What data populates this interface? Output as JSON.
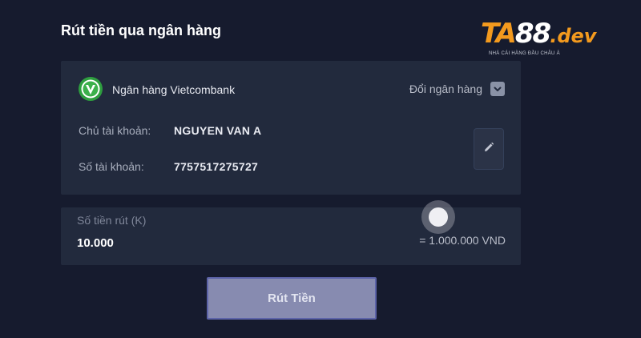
{
  "page": {
    "title": "Rút tiền qua ngân hàng"
  },
  "logo": {
    "brand_main": "TA",
    "brand_num": "88",
    "brand_suffix": ".dev",
    "tagline": "NHÀ CÁI HÀNG ĐẦU CHÂU Á"
  },
  "bank": {
    "icon": "vietcombank-logo-icon",
    "name": "Ngân hàng Vietcombank",
    "change_label": "Đổi ngân hàng",
    "holder_label": "Chủ tài khoản:",
    "holder_value": "NGUYEN VAN A",
    "account_label": "Số tài khoản:",
    "account_value": "7757517275727",
    "edit_icon": "pencil-icon"
  },
  "amount": {
    "placeholder": "Số tiền rút (K)",
    "value": "10.000",
    "converted": "= 1.000.000 VND"
  },
  "submit": {
    "label": "Rút Tiền"
  },
  "colors": {
    "background": "#161b2e",
    "card": "#222a3d",
    "accent_orange": "#f39a1e",
    "bank_green": "#2e9e3f",
    "button": "#878bb0"
  }
}
